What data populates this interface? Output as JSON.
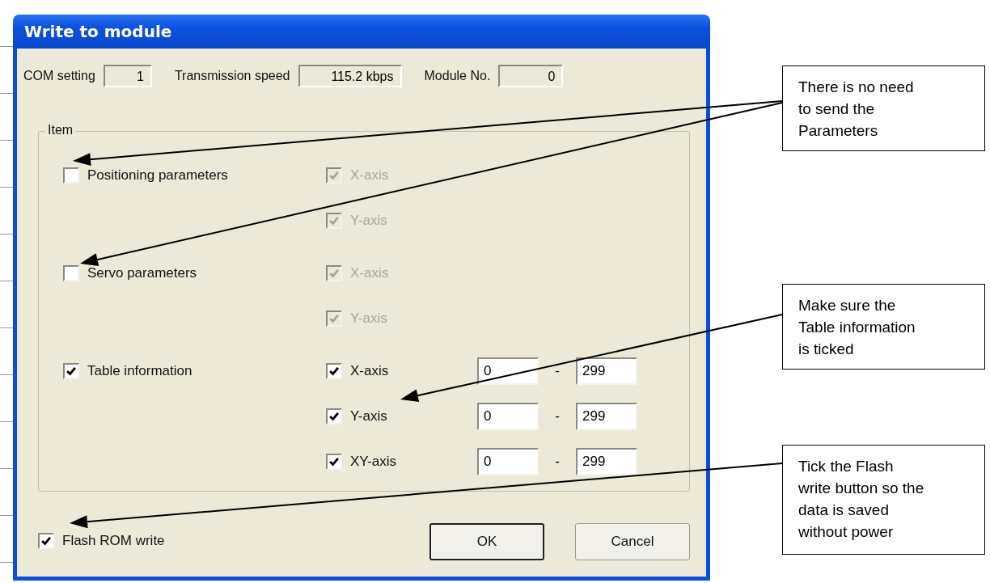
{
  "window": {
    "title": "Write to module"
  },
  "settings": [
    {
      "label": "COM setting",
      "value": "1"
    },
    {
      "label": "Transmission speed",
      "value": "115.2 kbps"
    },
    {
      "label": "Module No.",
      "value": "0"
    }
  ],
  "group": {
    "label": "Item",
    "sections": [
      {
        "label": "Positioning parameters",
        "checked": false,
        "axes": [
          {
            "label": "X-axis",
            "checked": true,
            "disabled": true
          },
          {
            "label": "Y-axis",
            "checked": true,
            "disabled": true
          }
        ]
      },
      {
        "label": "Servo parameters",
        "checked": false,
        "axes": [
          {
            "label": "X-axis",
            "checked": true,
            "disabled": true
          },
          {
            "label": "Y-axis",
            "checked": true,
            "disabled": true
          }
        ]
      },
      {
        "label": "Table information",
        "checked": true,
        "axes": [
          {
            "label": "X-axis",
            "checked": true,
            "disabled": false,
            "range": {
              "from": "0",
              "separator": "-",
              "to": "299"
            }
          },
          {
            "label": "Y-axis",
            "checked": true,
            "disabled": false,
            "range": {
              "from": "0",
              "separator": "-",
              "to": "299"
            }
          },
          {
            "label": "XY-axis",
            "checked": true,
            "disabled": false,
            "range": {
              "from": "0",
              "separator": "-",
              "to": "299"
            }
          }
        ]
      }
    ]
  },
  "flash_rom_write": {
    "label": "Flash ROM write",
    "checked": true
  },
  "buttons": [
    {
      "label": "OK",
      "default": true
    },
    {
      "label": "Cancel",
      "default": false
    }
  ],
  "callouts": [
    {
      "text": "There is no need\nto send the\nParameters"
    },
    {
      "text": "Make sure the\nTable information\nis ticked"
    },
    {
      "text": "Tick the Flash\nwrite button so the\ndata is saved\nwithout power"
    }
  ]
}
